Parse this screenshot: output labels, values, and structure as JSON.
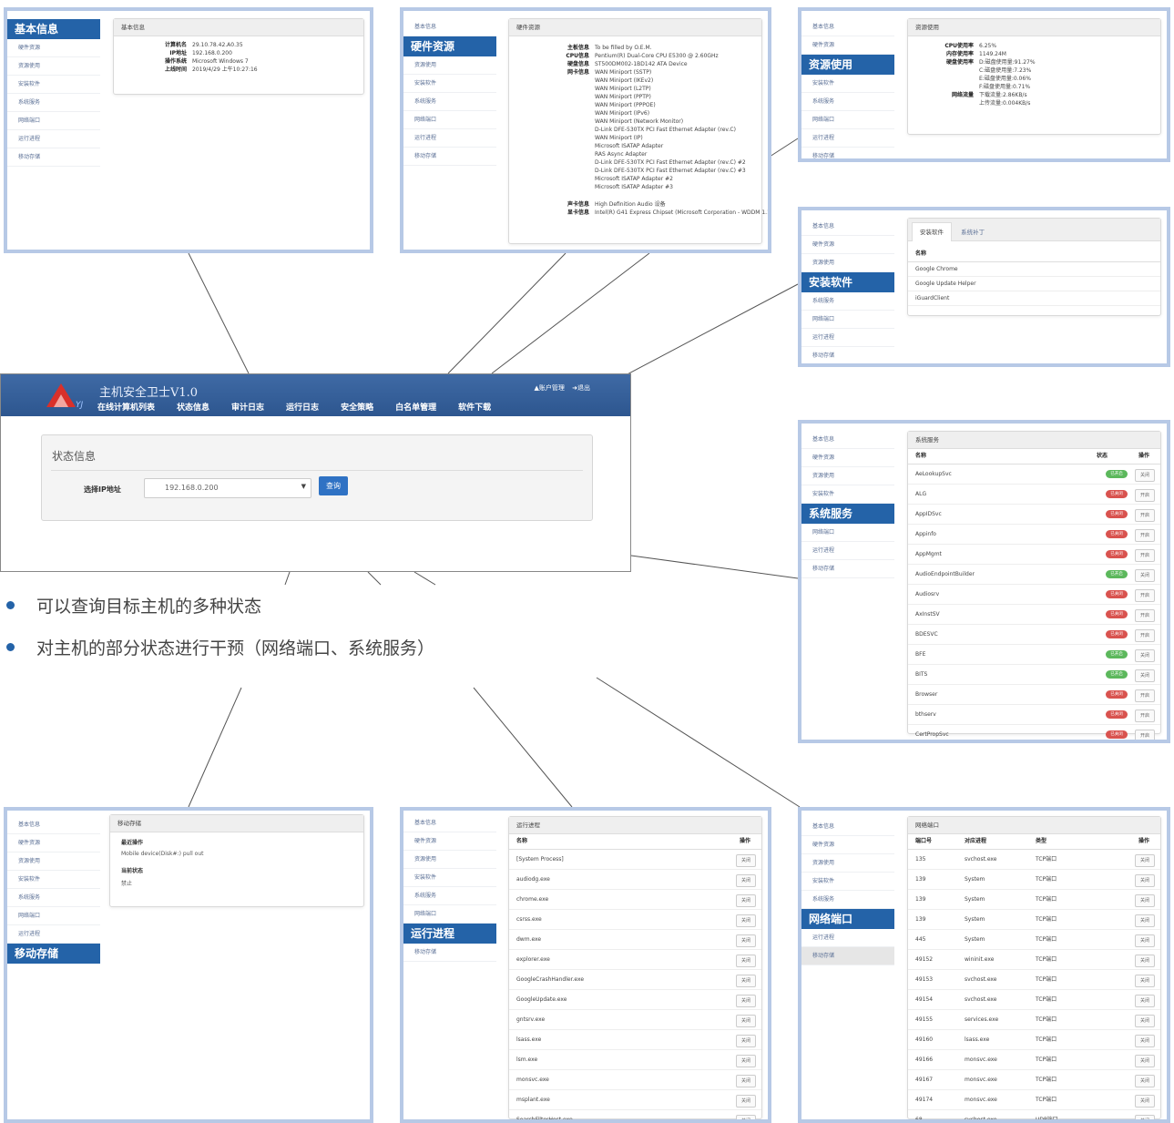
{
  "side_nav": [
    "基本信息",
    "硬件资源",
    "资源使用",
    "安装软件",
    "系统服务",
    "网络端口",
    "运行进程",
    "移动存储"
  ],
  "basic_info": {
    "highlight": "基本信息",
    "panel_title": "基本信息",
    "rows": [
      {
        "k": "计算机名",
        "v": "29.10.78.42.A0.35"
      },
      {
        "k": "IP地址",
        "v": "192.168.0.200"
      },
      {
        "k": "操作系统",
        "v": "Microsoft Windows 7"
      },
      {
        "k": "上线时间",
        "v": "2019/4/29 上午10:27:16"
      }
    ]
  },
  "hardware": {
    "highlight": "硬件资源",
    "panel_title": "硬件资源",
    "rows": [
      {
        "k": "主板信息",
        "v": "To be filled by O.E.M."
      },
      {
        "k": "CPU信息",
        "v": "Pentium(R) Dual-Core CPU E5300 @ 2.60GHz"
      },
      {
        "k": "硬盘信息",
        "v": "ST500DM002-1BD142 ATA Device"
      },
      {
        "k": "网卡信息",
        "v": "WAN Miniport (SSTP)"
      },
      {
        "k": "",
        "v": "WAN Miniport (IKEv2)"
      },
      {
        "k": "",
        "v": "WAN Miniport (L2TP)"
      },
      {
        "k": "",
        "v": "WAN Miniport (PPTP)"
      },
      {
        "k": "",
        "v": "WAN Miniport (PPPOE)"
      },
      {
        "k": "",
        "v": "WAN Miniport (IPv6)"
      },
      {
        "k": "",
        "v": "WAN Miniport (Network Monitor)"
      },
      {
        "k": "",
        "v": "D-Link DFE-530TX PCI Fast Ethernet Adapter (rev.C)"
      },
      {
        "k": "",
        "v": "WAN Miniport (IP)"
      },
      {
        "k": "",
        "v": "Microsoft ISATAP Adapter"
      },
      {
        "k": "",
        "v": "RAS Async Adapter"
      },
      {
        "k": "",
        "v": "D-Link DFE-530TX PCI Fast Ethernet Adapter (rev.C) #2"
      },
      {
        "k": "",
        "v": "D-Link DFE-530TX PCI Fast Ethernet Adapter (rev.C) #3"
      },
      {
        "k": "",
        "v": "Microsoft ISATAP Adapter #2"
      },
      {
        "k": "",
        "v": "Microsoft ISATAP Adapter #3"
      }
    ],
    "rows2": [
      {
        "k": "声卡信息",
        "v": "High Definition Audio 设备"
      },
      {
        "k": "显卡信息",
        "v": "Intel(R) G41 Express Chipset (Microsoft Corporation - WDDM 1.1)"
      }
    ]
  },
  "resource": {
    "highlight": "资源使用",
    "panel_title": "资源使用",
    "rows": [
      {
        "k": "CPU使用率",
        "v": "6.25%"
      },
      {
        "k": "内存使用率",
        "v": "1149.24M"
      },
      {
        "k": "硬盘使用率",
        "v": "D:磁盘使用量:91.27%"
      },
      {
        "k": "",
        "v": "C:磁盘使用量:7.23%"
      },
      {
        "k": "",
        "v": "E:磁盘使用量:0.06%"
      },
      {
        "k": "",
        "v": "F:磁盘使用量:0.71%"
      },
      {
        "k": "网络流量",
        "v": "下载流量:2.86KB/s"
      },
      {
        "k": "",
        "v": "上传流量:0.004KB/s"
      }
    ]
  },
  "software": {
    "highlight": "安装软件",
    "tabs": [
      "安装软件",
      "系统补丁"
    ],
    "col": "名称",
    "items": [
      "Google Chrome",
      "Google Update Helper",
      "iGuardClient"
    ]
  },
  "services": {
    "highlight": "系统服务",
    "panel_title": "系统服务",
    "cols": [
      "名称",
      "状态",
      "操作"
    ],
    "rows": [
      {
        "name": "AeLookupSvc",
        "state": "已开启",
        "color": "#5cb85c",
        "op": "关闭"
      },
      {
        "name": "ALG",
        "state": "已关闭",
        "color": "#d9534f",
        "op": "开启"
      },
      {
        "name": "AppIDSvc",
        "state": "已关闭",
        "color": "#d9534f",
        "op": "开启"
      },
      {
        "name": "Appinfo",
        "state": "已关闭",
        "color": "#d9534f",
        "op": "开启"
      },
      {
        "name": "AppMgmt",
        "state": "已关闭",
        "color": "#d9534f",
        "op": "开启"
      },
      {
        "name": "AudioEndpointBuilder",
        "state": "已开启",
        "color": "#5cb85c",
        "op": "关闭"
      },
      {
        "name": "Audiosrv",
        "state": "已关闭",
        "color": "#d9534f",
        "op": "开启"
      },
      {
        "name": "AxInstSV",
        "state": "已关闭",
        "color": "#d9534f",
        "op": "开启"
      },
      {
        "name": "BDESVC",
        "state": "已关闭",
        "color": "#d9534f",
        "op": "开启"
      },
      {
        "name": "BFE",
        "state": "已开启",
        "color": "#5cb85c",
        "op": "关闭"
      },
      {
        "name": "BITS",
        "state": "已开启",
        "color": "#5cb85c",
        "op": "关闭"
      },
      {
        "name": "Browser",
        "state": "已关闭",
        "color": "#d9534f",
        "op": "开启"
      },
      {
        "name": "bthserv",
        "state": "已关闭",
        "color": "#d9534f",
        "op": "开启"
      },
      {
        "name": "CertPropSvc",
        "state": "已关闭",
        "color": "#d9534f",
        "op": "开启"
      }
    ]
  },
  "usb": {
    "highlight": "移动存储",
    "panel_title": "移动存储",
    "recent_label": "最近操作",
    "recent_value": "Mobile device(Disk#:) pull out",
    "state_label": "当前状态",
    "state_value": "禁止"
  },
  "process": {
    "highlight": "运行进程",
    "panel_title": "运行进程",
    "cols": [
      "名称",
      "操作"
    ],
    "op": "关闭",
    "rows": [
      "[System Process]",
      "audiodg.exe",
      "chrome.exe",
      "csrss.exe",
      "dwm.exe",
      "explorer.exe",
      "GoogleCrashHandler.exe",
      "GoogleUpdate.exe",
      "gntsrv.exe",
      "lsass.exe",
      "lsm.exe",
      "monsvc.exe",
      "msplant.exe",
      "SearchFilterHost.exe"
    ]
  },
  "ports": {
    "highlight": "网络端口",
    "panel_title": "网络端口",
    "cols": [
      "端口号",
      "对应进程",
      "类型",
      "操作"
    ],
    "op": "关闭",
    "rows": [
      {
        "port": "135",
        "proc": "svchost.exe",
        "type": "TCP端口"
      },
      {
        "port": "139",
        "proc": "System",
        "type": "TCP端口"
      },
      {
        "port": "139",
        "proc": "System",
        "type": "TCP端口"
      },
      {
        "port": "139",
        "proc": "System",
        "type": "TCP端口"
      },
      {
        "port": "445",
        "proc": "System",
        "type": "TCP端口"
      },
      {
        "port": "49152",
        "proc": "wininit.exe",
        "type": "TCP端口"
      },
      {
        "port": "49153",
        "proc": "svchost.exe",
        "type": "TCP端口"
      },
      {
        "port": "49154",
        "proc": "svchost.exe",
        "type": "TCP端口"
      },
      {
        "port": "49155",
        "proc": "services.exe",
        "type": "TCP端口"
      },
      {
        "port": "49160",
        "proc": "lsass.exe",
        "type": "TCP端口"
      },
      {
        "port": "49166",
        "proc": "monsvc.exe",
        "type": "TCP端口"
      },
      {
        "port": "49167",
        "proc": "monsvc.exe",
        "type": "TCP端口"
      },
      {
        "port": "49174",
        "proc": "monsvc.exe",
        "type": "TCP端口"
      },
      {
        "port": "68",
        "proc": "svchost.exe",
        "type": "UDP端口"
      }
    ]
  },
  "main": {
    "app_title": "主机安全卫士V1.0",
    "nav": [
      "在线计算机列表",
      "状态信息",
      "审计日志",
      "运行日志",
      "安全策略",
      "白名单管理",
      "软件下载"
    ],
    "account": "账户管理",
    "logout": "退出",
    "card_title": "状态信息",
    "ip_label": "选择IP地址",
    "ip_value": "192.168.0.200",
    "query_btn": "查询"
  },
  "bullets": [
    "可以查询目标主机的多种状态",
    "对主机的部分状态进行干预（网络端口、系统服务）"
  ],
  "colors": {
    "accent": "#2463a8",
    "frame": "#b7c9e6",
    "nav": "#3a65a0"
  }
}
